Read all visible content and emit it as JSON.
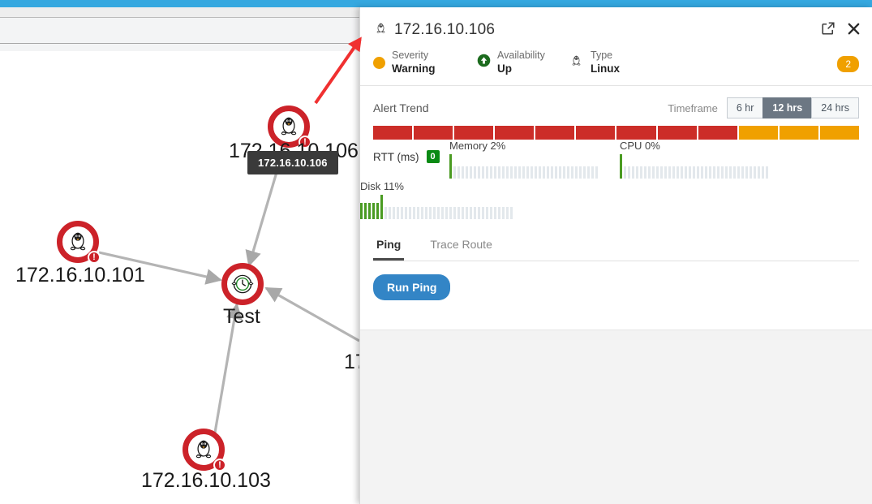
{
  "theme": {
    "accent_blue": "#35a8e0",
    "alert_red": "#cc2229",
    "warning_orange": "#f0a000",
    "ok_green": "#0a8a14",
    "button_blue": "#3385c6",
    "tab_selected_gray": "#6c7783"
  },
  "topology": {
    "nodes": [
      {
        "id": "n106",
        "label": "172.16.10.106",
        "icon": "linux-penguin-icon",
        "status": "alert"
      },
      {
        "id": "n101",
        "label": "172.16.10.101",
        "icon": "linux-penguin-icon",
        "status": "alert"
      },
      {
        "id": "ntest",
        "label": "Test",
        "icon": "clock-icon",
        "status": "alert"
      },
      {
        "id": "n103",
        "label": "172.16.10.103",
        "icon": "linux-penguin-icon",
        "status": "alert"
      },
      {
        "id": "nclipped",
        "label": "17",
        "icon": "none",
        "status": "alert"
      }
    ],
    "tooltip": "172.16.10.106"
  },
  "panel": {
    "title": "172.16.10.106",
    "title_icon": "linux-penguin-icon",
    "popout_icon": "external-link-icon",
    "close_icon": "close-icon",
    "alert_count": "2",
    "status": [
      {
        "label": "Severity",
        "value": "Warning",
        "icon": "severity-dot-icon"
      },
      {
        "label": "Availability",
        "value": "Up",
        "icon": "arrow-up-circle-icon"
      },
      {
        "label": "Type",
        "value": "Linux",
        "icon": "linux-penguin-icon"
      }
    ],
    "alert_trend": {
      "title": "Alert Trend",
      "timeframe_label": "Timeframe",
      "timeframe_options": [
        "6 hr",
        "12 hrs",
        "24 hrs"
      ],
      "timeframe_selected": "12 hrs",
      "segments": [
        "#cc2d28",
        "#cc2d28",
        "#cc2d28",
        "#cc2d28",
        "#cc2d28",
        "#cc2d28",
        "#cc2d28",
        "#cc2d28",
        "#cc2d28",
        "#f0a000",
        "#f0a000",
        "#f0a000"
      ]
    },
    "metrics": {
      "rtt": {
        "label": "RTT (ms)",
        "value": "0"
      },
      "memory": {
        "label": "Memory 2%",
        "percent": 2
      },
      "cpu": {
        "label": "CPU 0%",
        "percent": 0
      },
      "disk": {
        "label": "Disk 11%",
        "percent": 11
      }
    },
    "tabs": [
      {
        "label": "Ping",
        "active": true
      },
      {
        "label": "Trace Route",
        "active": false
      }
    ],
    "run_button": "Run Ping"
  }
}
